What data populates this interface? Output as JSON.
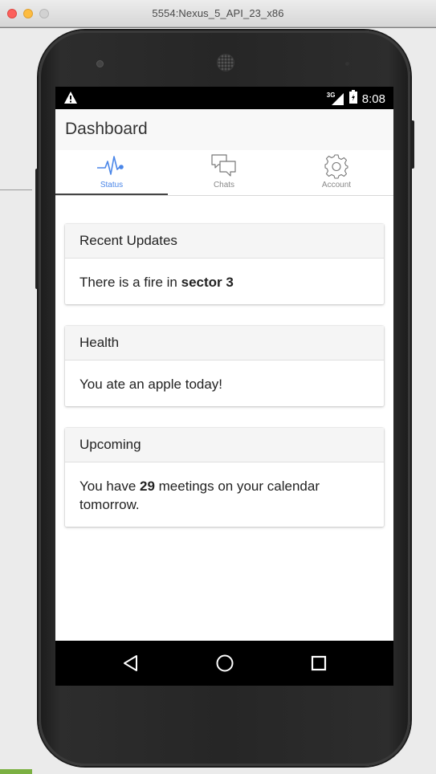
{
  "window": {
    "title": "5554:Nexus_5_API_23_x86"
  },
  "statusbar": {
    "network": "3G",
    "time": "8:08"
  },
  "appbar": {
    "title": "Dashboard"
  },
  "tabs": [
    {
      "label": "Status",
      "icon": "heartbeat-icon",
      "active": true
    },
    {
      "label": "Chats",
      "icon": "chat-bubbles-icon",
      "active": false
    },
    {
      "label": "Account",
      "icon": "gear-icon",
      "active": false
    }
  ],
  "cards": [
    {
      "header": "Recent Updates",
      "body_prefix": "There is a fire in ",
      "body_bold": "sector 3",
      "body_suffix": ""
    },
    {
      "header": "Health",
      "body_prefix": "You ate an apple today!",
      "body_bold": "",
      "body_suffix": ""
    },
    {
      "header": "Upcoming",
      "body_prefix": "You have ",
      "body_bold": "29",
      "body_suffix": " meetings on your calendar tomorrow."
    }
  ],
  "navbar": {
    "buttons": [
      "back-icon",
      "home-icon",
      "recents-icon"
    ]
  },
  "colors": {
    "accent": "#4a86e8",
    "tab_indicator": "#444444",
    "status_bar": "#000000",
    "nav_bar": "#000000",
    "card_header_bg": "#f5f5f5"
  }
}
